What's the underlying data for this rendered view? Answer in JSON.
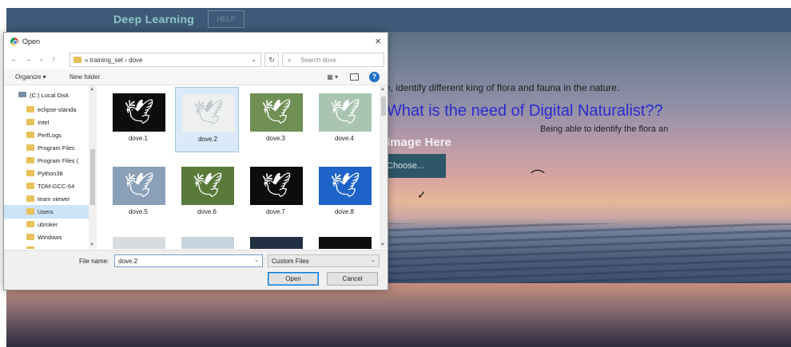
{
  "webpage": {
    "brand": "Deep Learning",
    "help_button": "HELP",
    "subtitle": "e, identify different king of flora and fauna in the nature.",
    "heading": "What is the need of Digital Naturalist??",
    "being_text": "Being able to identify the flora an",
    "upload_text": "Image Here",
    "choose_button": "Choose..."
  },
  "dialog": {
    "title": "Open",
    "close": "×",
    "breadcrumb": "« training_set  ›  dove",
    "search_placeholder": "Search dove",
    "organize": "Organize ▾",
    "new_folder": "New folder",
    "nav_tree": {
      "drive": "(C:) Local Disk",
      "folders": [
        "eclipse-standa",
        "Intel",
        "PerfLogs",
        "Program Files",
        "Program Files (",
        "Python38",
        "TDM-GCC-64",
        "team viewer",
        "Users",
        "ubroker",
        "Windows",
        "sserver"
      ],
      "selected": "Users"
    },
    "files": [
      {
        "name": "dove.1",
        "bg": "#0d0d0d"
      },
      {
        "name": "dove.2",
        "bg": "#eef0f0",
        "selected": true
      },
      {
        "name": "dove.3",
        "bg": "#6f8f55"
      },
      {
        "name": "dove.4",
        "bg": "#a9c4b0"
      },
      {
        "name": "dove.5",
        "bg": "#8aa0b8"
      },
      {
        "name": "dove.6",
        "bg": "#5a7a3a"
      },
      {
        "name": "dove.7",
        "bg": "#0d0d0d"
      },
      {
        "name": "dove.8",
        "bg": "#1d63c8"
      }
    ],
    "file_name_label": "File name:",
    "file_name_value": "dove.2",
    "filter": "Custom Files",
    "open_button": "Open",
    "cancel_button": "Cancel"
  }
}
